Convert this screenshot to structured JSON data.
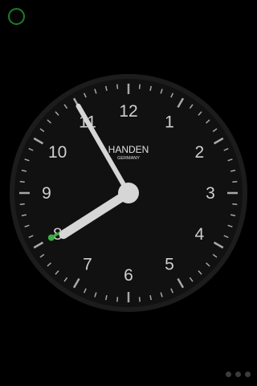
{
  "clock": {
    "brand": "HANDEN",
    "subtitle": "GERMANY",
    "numerals": [
      "12",
      "1",
      "2",
      "3",
      "4",
      "5",
      "6",
      "7",
      "8",
      "9",
      "10",
      "11"
    ],
    "time": {
      "hour": 7,
      "minute": 55,
      "alarm_hour": 8,
      "alarm_minute": 0
    },
    "colors": {
      "face": "#111111",
      "bezel": "#1c1c1c",
      "numerals": "#cfcfcf",
      "ticks": "#a8a8a8",
      "hands": "#d6d6d6",
      "alarm_hand": "#3cb043",
      "brand_text": "#e0e0e0"
    }
  },
  "controls": {
    "settings_button": {
      "icon": "alarm-toggle-icon",
      "color": "#1f7a2a"
    },
    "page_indicator": {
      "pages": 3,
      "active": 0
    }
  }
}
